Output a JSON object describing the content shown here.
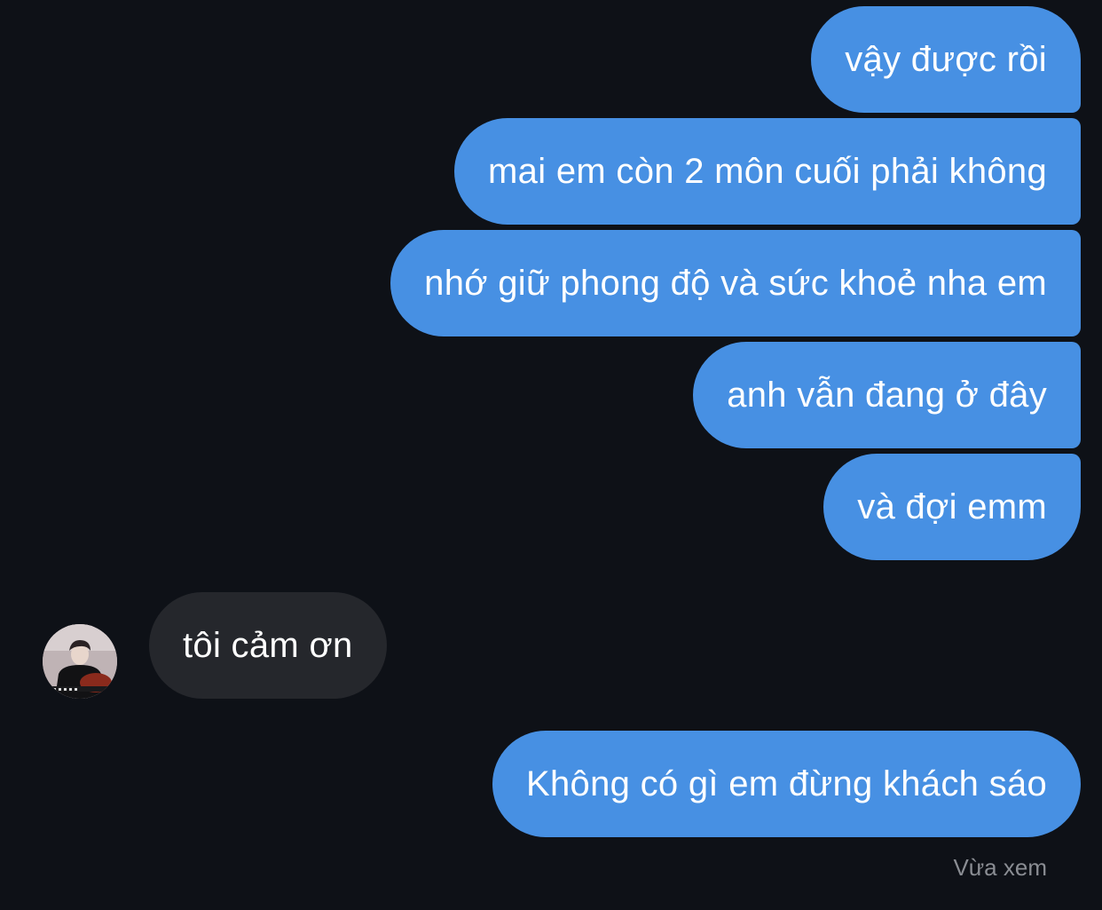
{
  "messages": {
    "outgoing_group": [
      {
        "text": "vậy được rồi"
      },
      {
        "text": "mai em còn 2 môn cuối phải không"
      },
      {
        "text": "nhớ giữ phong độ và sức khoẻ nha em"
      },
      {
        "text": "anh vẫn đang ở đây"
      },
      {
        "text": "và đợi emm"
      }
    ],
    "incoming": {
      "text": "tôi cảm ơn"
    },
    "outgoing_reply": {
      "text": "Không có gì em đừng khách sáo"
    }
  },
  "status": {
    "seen": "Vừa xem"
  },
  "colors": {
    "background": "#0e1117",
    "outgoing_bubble": "#4790e3",
    "incoming_bubble": "#25272c",
    "text": "#ffffff",
    "status_text": "#8a8d93"
  }
}
